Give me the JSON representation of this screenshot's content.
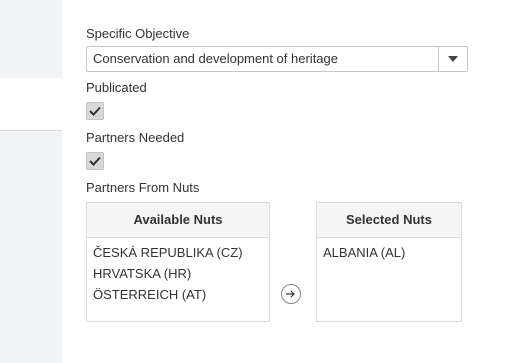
{
  "specific_objective": {
    "label": "Specific Objective",
    "selected_value": "Conservation and development of heritage"
  },
  "publicated": {
    "label": "Publicated",
    "checked": true
  },
  "partners_needed": {
    "label": "Partners Needed",
    "checked": true
  },
  "partners_from_nuts": {
    "label": "Partners From Nuts",
    "available": {
      "header": "Available Nuts",
      "items": [
        "ČESKÁ REPUBLIKA (CZ)",
        "HRVATSKA (HR)",
        "ÖSTERREICH (AT)"
      ]
    },
    "selected": {
      "header": "Selected Nuts",
      "items": [
        "ALBANIA (AL)"
      ]
    }
  },
  "icons": {
    "dropdown": "chevron-down-icon",
    "check": "checkmark-icon",
    "move": "arrow-right-circle-icon"
  },
  "colors": {
    "checkbox_bg": "#d8d8d8",
    "header_bg": "#f5f5f5",
    "page_bg": "#f3f4f6"
  }
}
